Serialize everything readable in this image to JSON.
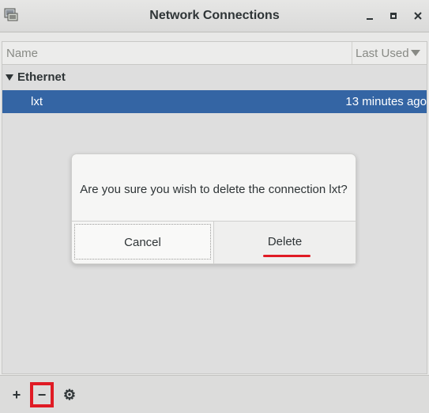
{
  "window": {
    "title": "Network Connections",
    "minimize_label": "_",
    "maximize_label": "□",
    "close_label": "x"
  },
  "list": {
    "columns": {
      "name": "Name",
      "last_used": "Last Used"
    },
    "groups": [
      {
        "label": "Ethernet",
        "connections": [
          {
            "name": "lxt",
            "last_used": "13 minutes ago"
          }
        ]
      }
    ]
  },
  "dialog": {
    "message": "Are you sure you wish to delete the connection lxt?",
    "cancel_label": "Cancel",
    "delete_label": "Delete"
  },
  "toolbar": {
    "add_label": "+",
    "remove_label": "−",
    "settings_label": "⚙"
  },
  "colors": {
    "selection": "#3465a4",
    "annotation_red": "#e01b24"
  }
}
